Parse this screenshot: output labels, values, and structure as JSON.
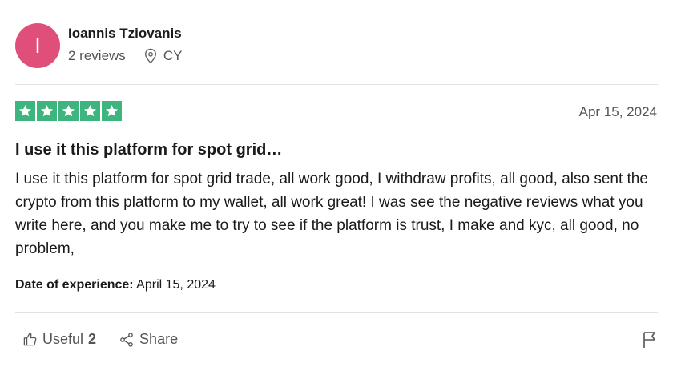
{
  "reviewer": {
    "avatar_letter": "I",
    "avatar_color": "#e04f7a",
    "name": "Ioannis Tziovanis",
    "reviews_count": "2 reviews",
    "country": "CY",
    "location_icon": "location-pin-icon"
  },
  "review": {
    "rating": 5,
    "star_color": "#3eb47e",
    "date": "Apr 15, 2024",
    "title": "I use it this platform for spot grid…",
    "body": "I use it this platform for spot grid trade, all work good, I withdraw profits, all good, also sent the crypto from this platform to my wallet, all work great! I was see the negative reviews what you write here, and you make me to try to see if the platform is trust, I make and kyc, all good, no problem,",
    "experience_label": "Date of experience:",
    "experience_date": "April 15, 2024"
  },
  "actions": {
    "useful_label": "Useful",
    "useful_count": "2",
    "useful_icon": "thumbs-up-icon",
    "share_label": "Share",
    "share_icon": "share-icon",
    "flag_icon": "flag-icon"
  }
}
